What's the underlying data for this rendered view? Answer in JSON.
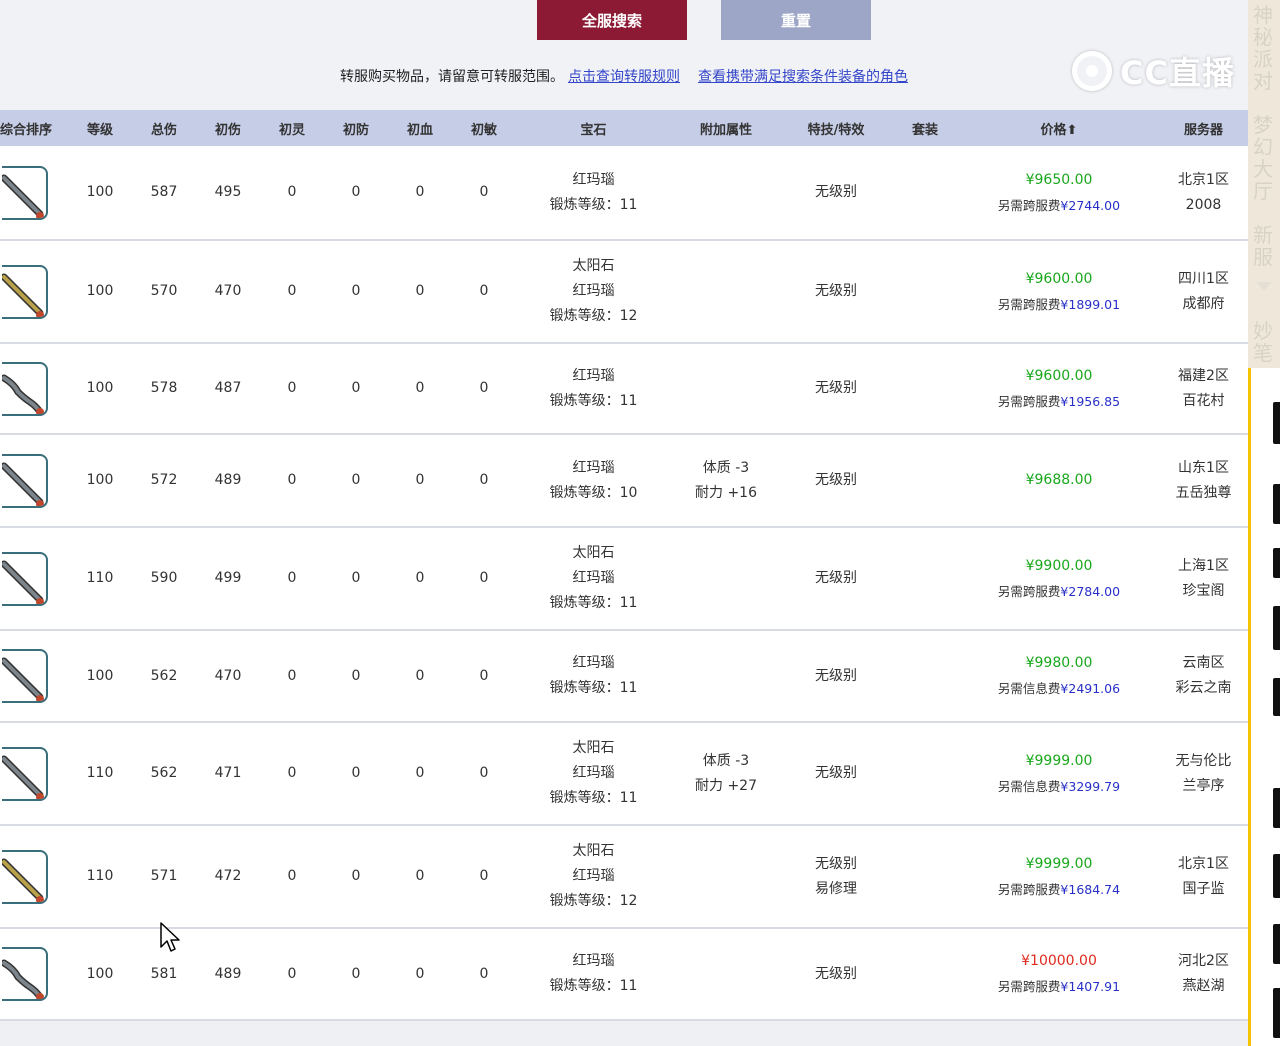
{
  "toolbar": {
    "search_all_label": "全服搜索",
    "reset_label": "重置"
  },
  "notice": {
    "text": "转服购买物品，请留意可转服范围。",
    "link1": "点击查询转服规则",
    "link2": "查看携带满足搜索条件装备的角色"
  },
  "logo": {
    "text": "CC直播"
  },
  "table": {
    "headers": [
      "综合排序",
      "等级",
      "总伤",
      "初伤",
      "初灵",
      "初防",
      "初血",
      "初敏",
      "宝石",
      "附加属性",
      "特技/特效",
      "套装",
      "价格⬆",
      "服务器"
    ],
    "rows": [
      {
        "level": "100",
        "total": "587",
        "dmg": "495",
        "ling": "0",
        "def": "0",
        "hp": "0",
        "agi": "0",
        "gems": [
          "红玛瑙",
          "锻炼等级：11"
        ],
        "attrs": [],
        "skills": [
          "无级别"
        ],
        "set": "",
        "price": "¥9650.00",
        "price_color": "green",
        "fee_label": "另需跨服费",
        "fee": "¥2744.00",
        "server": [
          "北京1区",
          "2008"
        ],
        "icon": "sword-gray"
      },
      {
        "level": "100",
        "total": "570",
        "dmg": "470",
        "ling": "0",
        "def": "0",
        "hp": "0",
        "agi": "0",
        "gems": [
          "太阳石",
          "红玛瑙",
          "锻炼等级：12"
        ],
        "attrs": [],
        "skills": [
          "无级别"
        ],
        "set": "",
        "price": "¥9600.00",
        "price_color": "green",
        "fee_label": "另需跨服费",
        "fee": "¥1899.01",
        "server": [
          "四川1区",
          "成都府"
        ],
        "icon": "sword-gold"
      },
      {
        "level": "100",
        "total": "578",
        "dmg": "487",
        "ling": "0",
        "def": "0",
        "hp": "0",
        "agi": "0",
        "gems": [
          "红玛瑙",
          "锻炼等级：11"
        ],
        "attrs": [],
        "skills": [
          "无级别"
        ],
        "set": "",
        "price": "¥9600.00",
        "price_color": "green",
        "fee_label": "另需跨服费",
        "fee": "¥1956.85",
        "server": [
          "福建2区",
          "百花村"
        ],
        "icon": "sword-wavy"
      },
      {
        "level": "100",
        "total": "572",
        "dmg": "489",
        "ling": "0",
        "def": "0",
        "hp": "0",
        "agi": "0",
        "gems": [
          "红玛瑙",
          "锻炼等级：10"
        ],
        "attrs": [
          "体质 -3",
          "耐力 +16"
        ],
        "skills": [
          "无级别"
        ],
        "set": "",
        "price": "¥9688.00",
        "price_color": "green",
        "fee_label": "",
        "fee": "",
        "server": [
          "山东1区",
          "五岳独尊"
        ],
        "icon": "sword-gray"
      },
      {
        "level": "110",
        "total": "590",
        "dmg": "499",
        "ling": "0",
        "def": "0",
        "hp": "0",
        "agi": "0",
        "gems": [
          "太阳石",
          "红玛瑙",
          "锻炼等级：11"
        ],
        "attrs": [],
        "skills": [
          "无级别"
        ],
        "set": "",
        "price": "¥9900.00",
        "price_color": "green",
        "fee_label": "另需跨服费",
        "fee": "¥2784.00",
        "server": [
          "上海1区",
          "珍宝阁"
        ],
        "icon": "sword-gray"
      },
      {
        "level": "100",
        "total": "562",
        "dmg": "470",
        "ling": "0",
        "def": "0",
        "hp": "0",
        "agi": "0",
        "gems": [
          "红玛瑙",
          "锻炼等级：11"
        ],
        "attrs": [],
        "skills": [
          "无级别"
        ],
        "set": "",
        "price": "¥9980.00",
        "price_color": "green",
        "fee_label": "另需信息费",
        "fee": "¥2491.06",
        "server": [
          "云南区",
          "彩云之南"
        ],
        "icon": "sword-gray"
      },
      {
        "level": "110",
        "total": "562",
        "dmg": "471",
        "ling": "0",
        "def": "0",
        "hp": "0",
        "agi": "0",
        "gems": [
          "太阳石",
          "红玛瑙",
          "锻炼等级：11"
        ],
        "attrs": [
          "体质 -3",
          "耐力 +27"
        ],
        "skills": [
          "无级别"
        ],
        "set": "",
        "price": "¥9999.00",
        "price_color": "green",
        "fee_label": "另需信息费",
        "fee": "¥3299.79",
        "server": [
          "无与伦比",
          "兰亭序"
        ],
        "icon": "sword-gray"
      },
      {
        "level": "110",
        "total": "571",
        "dmg": "472",
        "ling": "0",
        "def": "0",
        "hp": "0",
        "agi": "0",
        "gems": [
          "太阳石",
          "红玛瑙",
          "锻炼等级：12"
        ],
        "attrs": [],
        "skills": [
          "无级别",
          "易修理"
        ],
        "set": "",
        "price": "¥9999.00",
        "price_color": "green",
        "fee_label": "另需跨服费",
        "fee": "¥1684.74",
        "server": [
          "北京1区",
          "国子监"
        ],
        "icon": "sword-gold"
      },
      {
        "level": "100",
        "total": "581",
        "dmg": "489",
        "ling": "0",
        "def": "0",
        "hp": "0",
        "agi": "0",
        "gems": [
          "红玛瑙",
          "锻炼等级：11"
        ],
        "attrs": [],
        "skills": [
          "无级别"
        ],
        "set": "",
        "price": "¥10000.00",
        "price_color": "red",
        "fee_label": "另需跨服费",
        "fee": "¥1407.91",
        "server": [
          "河北2区",
          "燕赵湖"
        ],
        "icon": "sword-wavy"
      }
    ]
  },
  "side_panel": {
    "items": [
      "神秘派对",
      "梦幻大厅",
      "新服",
      "妙笔"
    ]
  },
  "colors": {
    "header_bg": "#c6cde6",
    "primary_button": "#8c1a35",
    "reset_button": "#9da6c6",
    "price_green": "#19a81c",
    "price_red": "#e02a1e",
    "link_blue": "#3446c9"
  }
}
